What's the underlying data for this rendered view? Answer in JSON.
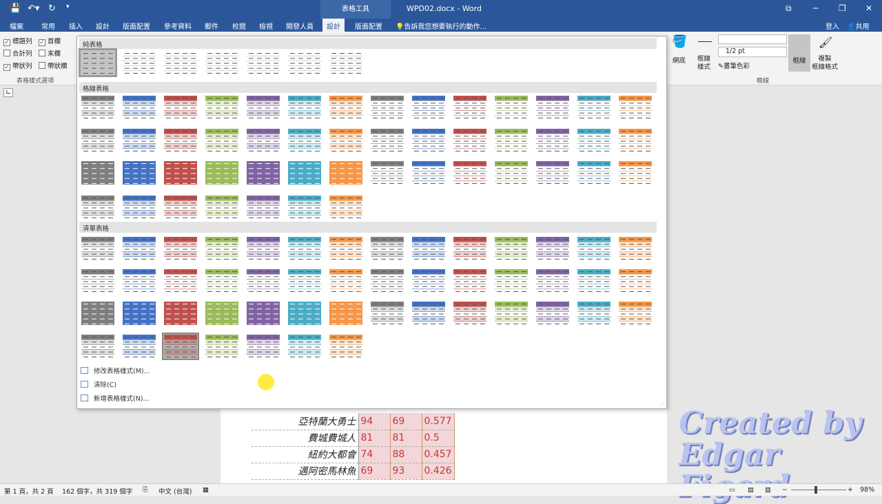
{
  "titlebar": {
    "context": "表格工具",
    "title": "WPD02.docx - Word",
    "controls": [
      "⧉",
      "─",
      "❐",
      "✕"
    ]
  },
  "tabs": {
    "file": "檔案",
    "home": "常用",
    "insert": "插入",
    "design1": "設計",
    "layout1": "版面配置",
    "references": "參考資料",
    "mailings": "郵件",
    "review": "校閱",
    "view": "檢視",
    "developer": "開發人員",
    "design2": "設計",
    "layout2": "版面配置",
    "tell": "告訴我您想要執行的動作...",
    "signin": "登入",
    "share": "共用"
  },
  "options": {
    "header_row": "標題列",
    "first_col": "首欄",
    "total_row": "合計列",
    "last_col": "末欄",
    "banded_rows": "帶狀列",
    "banded_cols": "帶狀欄",
    "group": "表格樣式選項"
  },
  "borders": {
    "shading": "網底",
    "border_styles": "框線\n樣式",
    "weight": "1/2 pt",
    "pen": "畫筆色彩",
    "borders": "框線",
    "painter": "複製\n框線格式",
    "group": "框線"
  },
  "gallery": {
    "sec1": "純表格",
    "sec2": "格線表格",
    "sec3": "清單表格",
    "cmd_modify": "修改表格樣式(M)...",
    "cmd_clear": "清除(C)",
    "cmd_new": "新增表格樣式(N)..."
  },
  "table": [
    {
      "name": "亞特蘭大勇士",
      "w": "94",
      "l": "69",
      "p": "0.577"
    },
    {
      "name": "費城費城人",
      "w": "81",
      "l": "81",
      "p": "0.5"
    },
    {
      "name": "紐約大都會",
      "w": "74",
      "l": "88",
      "p": "0.457"
    },
    {
      "name": "邁阿密馬林魚",
      "w": "69",
      "l": "93",
      "p": "0.426"
    }
  ],
  "status": {
    "page": "第 1 頁，共 2 頁",
    "words": "162 個字，共 319 個字",
    "lang": "中文 (台灣)",
    "zoom": "98%"
  },
  "watermark": {
    "line1": "Created by",
    "line2": "Edgar Figard"
  },
  "colors": [
    "#7f7f7f",
    "#4472c4",
    "#c0504d",
    "#9bbb59",
    "#8064a2",
    "#4bacc6",
    "#f79646"
  ]
}
